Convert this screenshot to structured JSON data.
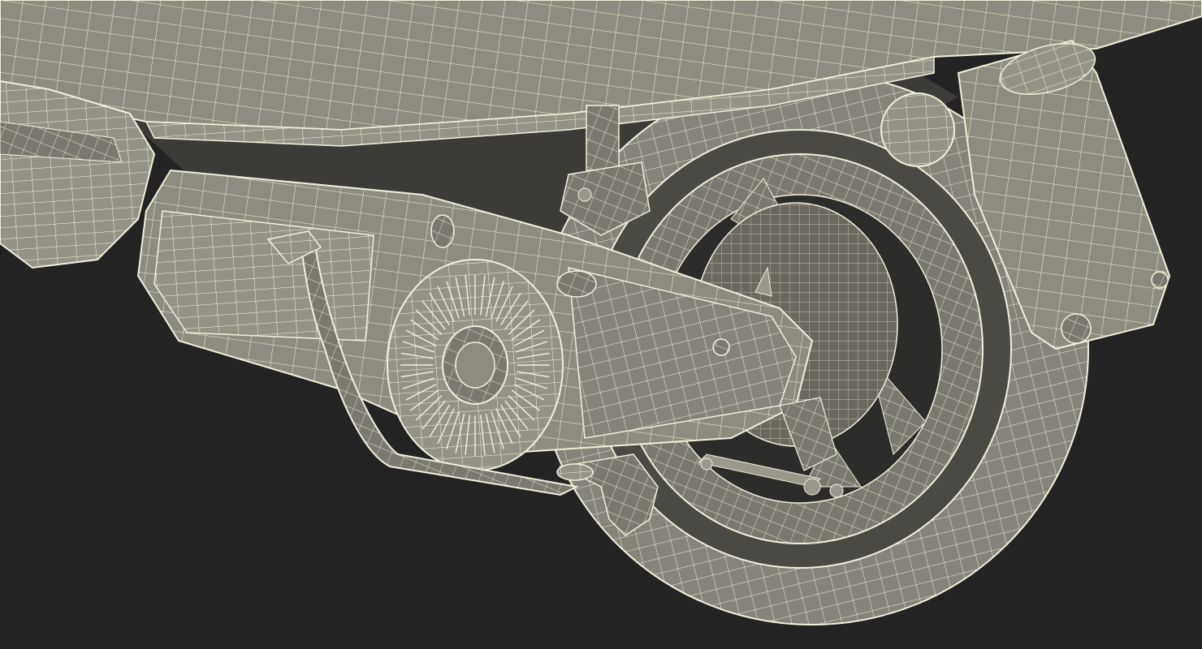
{
  "scene": {
    "subject": "scooter-rear-wireframe-render",
    "background_color": "#232323",
    "surface_color": "#8e8c80",
    "surface_dark": "#6f6d63",
    "surface_light": "#a6a497",
    "wire_color": "#f1efdc",
    "parts": [
      "seat-body-panel",
      "rear-tire",
      "wheel-rim",
      "engine-belt-case",
      "cooling-fan-cover",
      "rear-shock-absorber",
      "rear-mudguard",
      "tail-light",
      "exhaust-pipe",
      "brake-linkage",
      "center-stand"
    ]
  }
}
